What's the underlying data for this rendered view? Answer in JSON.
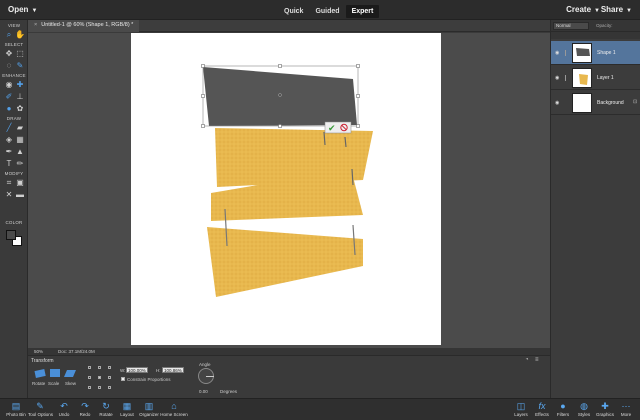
{
  "topbar": {
    "open_label": "Open",
    "modes": [
      "Quick",
      "Guided",
      "Expert"
    ],
    "active_mode": "Expert",
    "create_label": "Create",
    "share_label": "Share"
  },
  "document_tab": {
    "title": "Untitled-1 @ 60% (Shape 1, RGB/8) *"
  },
  "toolbox": {
    "sections": [
      "VIEW",
      "SELECT",
      "ENHANCE",
      "DRAW",
      "MODIFY",
      "COLOR"
    ],
    "foreground_color": "#4a4a4a",
    "background_color": "#ffffff"
  },
  "statusbar": {
    "zoom": "50%",
    "doc_info": "Doc: 37.1M/24.0M"
  },
  "tool_options": {
    "title": "Transform",
    "modes": [
      "Rotate",
      "Scale",
      "Skew"
    ],
    "width_label": "W:",
    "width_value": "100.00%",
    "height_label": "H:",
    "height_value": "100.86%",
    "constrain_label": "Constrain Proportions",
    "angle_label": "Angle",
    "angle_value": "0.00",
    "degrees_label": "Degrees"
  },
  "layers_panel": {
    "blend_mode": "Normal",
    "opacity_label": "Opacity:",
    "layers": [
      {
        "name": "Shape 1",
        "selected": true
      },
      {
        "name": "Layer 1",
        "selected": false
      },
      {
        "name": "Background",
        "selected": false
      }
    ]
  },
  "taskbar": {
    "left": [
      "Photo Bin",
      "Tool Options",
      "Undo",
      "Redo",
      "Rotate",
      "Layout",
      "Organizer",
      "Home Screen"
    ],
    "right": [
      "Layers",
      "Effects",
      "Filters",
      "Styles",
      "Graphics",
      "More"
    ]
  },
  "colors": {
    "accent": "#54a0e8",
    "selected_layer": "#54759c",
    "shape_fill": "#555555",
    "paper": "#e8b84e"
  }
}
